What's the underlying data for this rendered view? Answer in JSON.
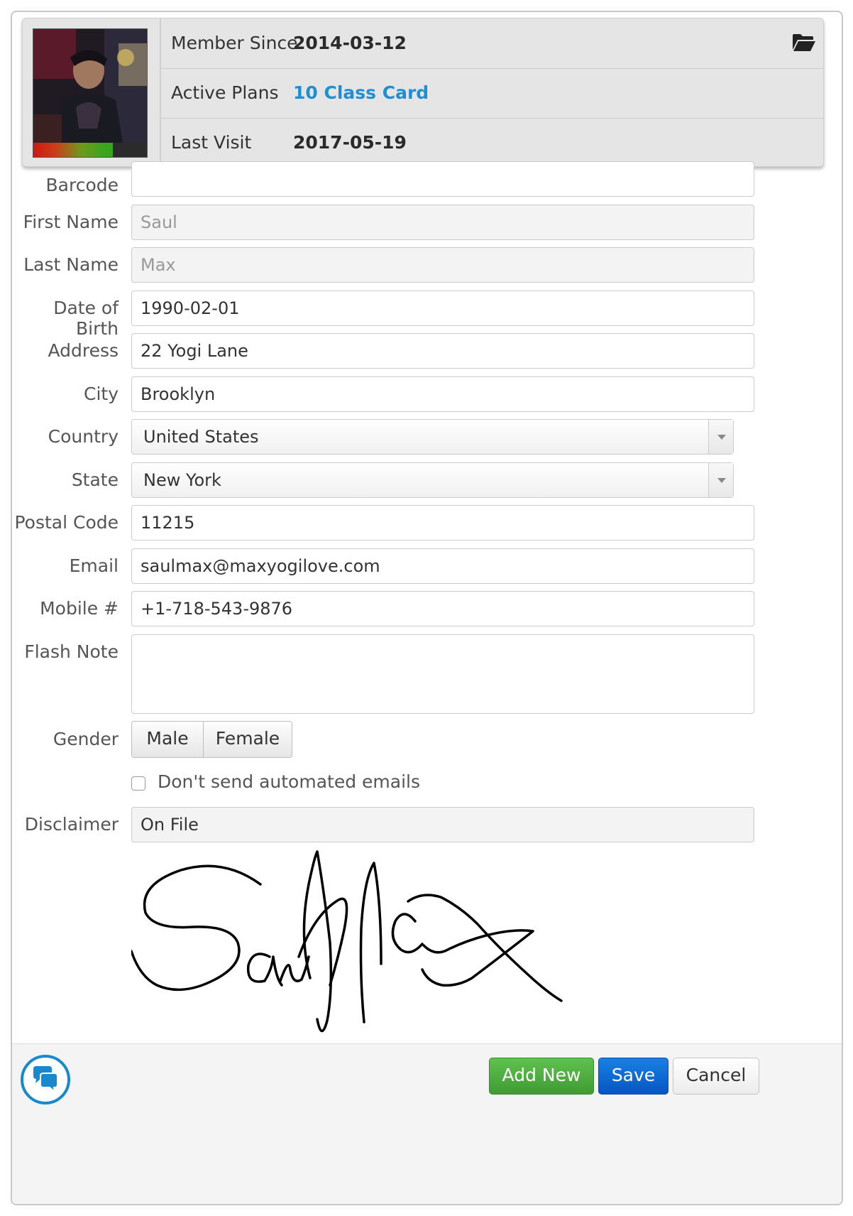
{
  "profile": {
    "photo_alt": "Member photo",
    "member_since_label": "Member Since",
    "member_since_value": "2014-03-12",
    "active_plans_label": "Active Plans",
    "active_plans_value": "10 Class Card",
    "last_visit_label": "Last Visit",
    "last_visit_value": "2017-05-19",
    "folder_icon": "folder-open-icon"
  },
  "form": {
    "barcode": {
      "label": "Barcode",
      "value": ""
    },
    "first_name": {
      "label": "First Name",
      "placeholder": "Saul"
    },
    "last_name": {
      "label": "Last Name",
      "placeholder": "Max"
    },
    "dob": {
      "label": "Date of Birth",
      "value": "1990-02-01"
    },
    "address": {
      "label": "Address",
      "value": "22 Yogi Lane"
    },
    "city": {
      "label": "City",
      "value": "Brooklyn"
    },
    "country": {
      "label": "Country",
      "value": "United States"
    },
    "state": {
      "label": "State",
      "value": "New York"
    },
    "postal_code": {
      "label": "Postal Code",
      "value": "11215"
    },
    "email": {
      "label": "Email",
      "value": "saulmax@maxyogilove.com"
    },
    "mobile": {
      "label": "Mobile #",
      "value": "+1-718-543-9876"
    },
    "flash_note": {
      "label": "Flash Note",
      "value": ""
    },
    "gender": {
      "label": "Gender",
      "options": [
        "Male",
        "Female"
      ]
    },
    "no_emails": {
      "label": "Don't send automated emails",
      "checked": false
    },
    "disclaimer": {
      "label": "Disclaimer",
      "value": "On File"
    }
  },
  "footer": {
    "chat_icon": "chat-bubbles-icon",
    "add_new": "Add New",
    "save": "Save",
    "cancel": "Cancel"
  },
  "colors": {
    "link": "#1f8fd1",
    "add_new_bg": "#4cae3f",
    "save_bg": "#0a64d4",
    "chat_ring": "#1a88cc"
  }
}
